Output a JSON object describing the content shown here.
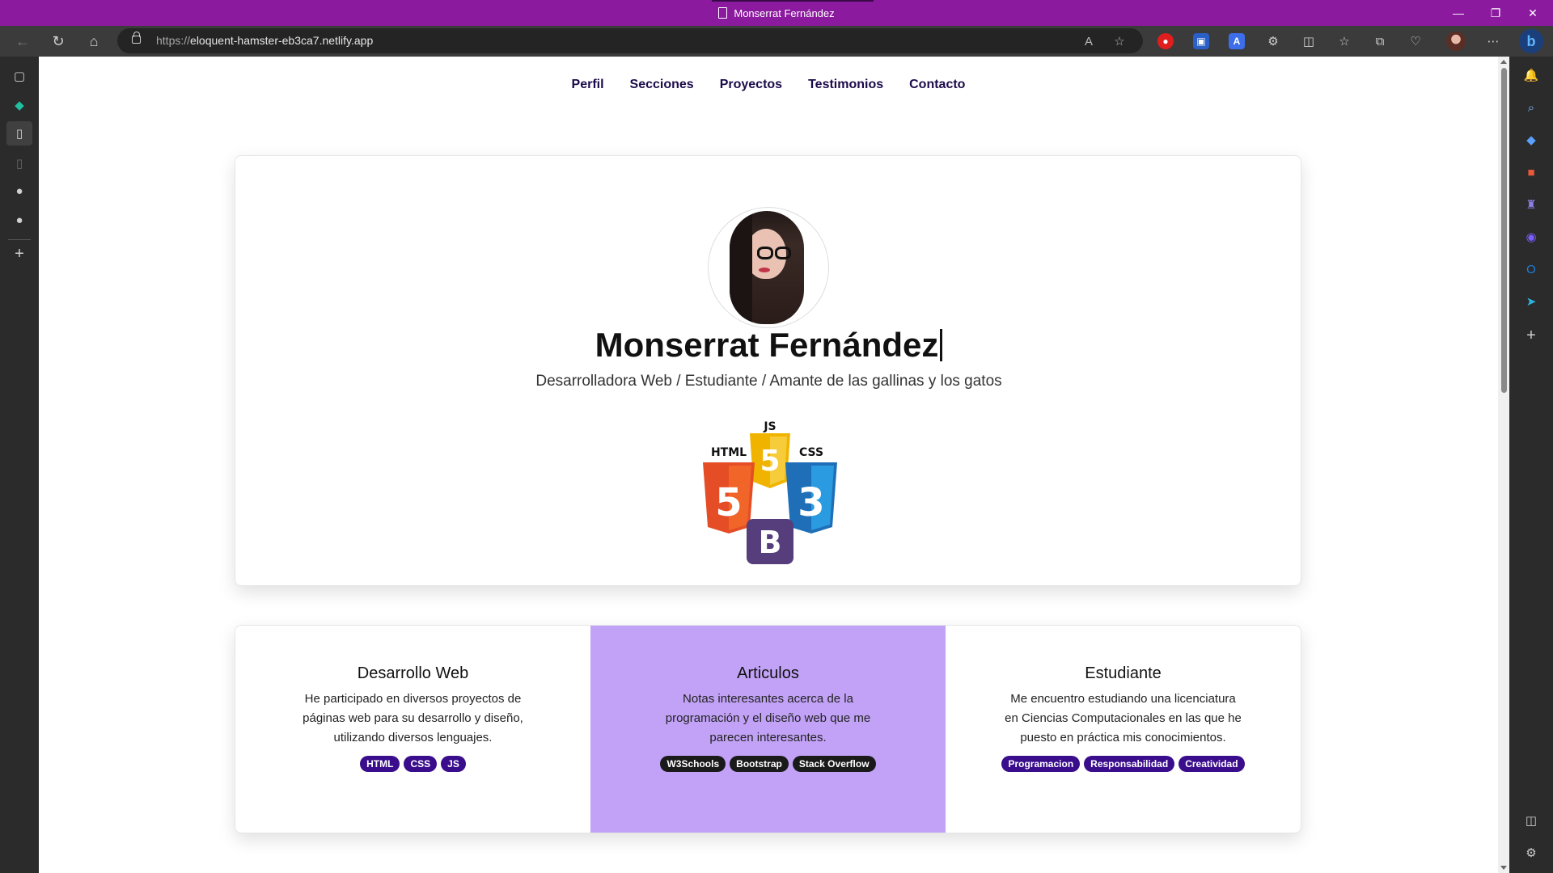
{
  "window": {
    "title": "Monserrat Fernández",
    "controls": [
      "—",
      "❐",
      "✕"
    ]
  },
  "browser": {
    "url_protocol": "https://",
    "url_host": "eloquent-hamster-eb3ca7.netlify.app"
  },
  "nav": {
    "items": [
      "Perfil",
      "Secciones",
      "Proyectos",
      "Testimonios",
      "Contacto"
    ]
  },
  "hero": {
    "name": "Monserrat Fernández",
    "subtitle": "Desarrolladora Web / Estudiante / Amante de las gallinas y los gatos",
    "logo_labels": {
      "js": "JS",
      "html": "HTML",
      "css": "CSS",
      "html_num": "5",
      "css_num": "3",
      "js_num": "5",
      "bootstrap": "B"
    }
  },
  "cards": [
    {
      "title": "Desarrollo Web",
      "text": "He participado en diversos proyectos de páginas web para su desarrollo y diseño, utilizando diversos lenguajes.",
      "tags": [
        "HTML",
        "CSS",
        "JS"
      ],
      "tag_style": "violet"
    },
    {
      "title": "Articulos",
      "text": "Notas interesantes acerca de la programación y el diseño web que me parecen interesantes.",
      "tags": [
        "W3Schools",
        "Bootstrap",
        "Stack Overflow"
      ],
      "tag_style": "dark"
    },
    {
      "title": "Estudiante",
      "text": "Me encuentro estudiando una licenciatura en Ciencias Computacionales en las que he puesto en práctica mis conocimientos.",
      "tags": [
        "Programacion",
        "Responsabilidad",
        "Creatividad"
      ],
      "tag_style": "violet"
    }
  ],
  "colors": {
    "titlebar": "#8b1a9e",
    "nav_text": "#1c0a4a",
    "card_highlight": "#c2a2f6",
    "tag_violet": "#3a0d8c",
    "tag_dark": "#1a1a1a",
    "html_orange": "#e44d26",
    "css_blue": "#1e8bd1",
    "js_yellow": "#f0b400",
    "bootstrap_purple": "#563d7c"
  },
  "icons": {
    "left_sidebar": [
      "tabs-icon",
      "diamond-icon",
      "page-icon",
      "page-faded-icon",
      "github-icon",
      "github-icon",
      "plus-icon"
    ],
    "right_sidebar": [
      "bell-icon",
      "search-icon",
      "tag-icon",
      "toolbox-icon",
      "chess-icon",
      "copilot-icon",
      "outlook-icon",
      "send-icon",
      "plus-icon",
      "sidebar-toggle-icon",
      "settings-icon"
    ]
  }
}
